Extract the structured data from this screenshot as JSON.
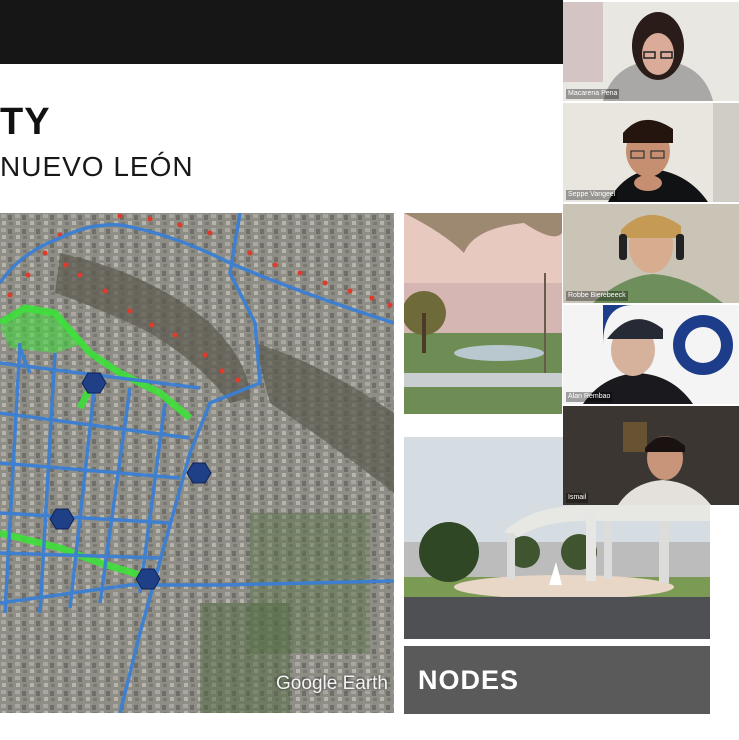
{
  "slide": {
    "title": "TY",
    "subtitle": "NUEVO LEÓN",
    "map_credit": "Google Earth",
    "nodes_label": "NODES"
  },
  "colors": {
    "top_bar": "#161616",
    "route_blue": "#3b7fd4",
    "green_path": "#3ee03a",
    "node_blue": "#1f3f86",
    "rail_red": "#e23a2a",
    "nodes_bg": "#5a5a5a"
  },
  "participants": [
    {
      "name": "Macarena Pena"
    },
    {
      "name": "Seppe Vangeel"
    },
    {
      "name": "Robbe Bierebeeck"
    },
    {
      "name": "Alan Rembao"
    },
    {
      "name": "Ismail"
    }
  ]
}
